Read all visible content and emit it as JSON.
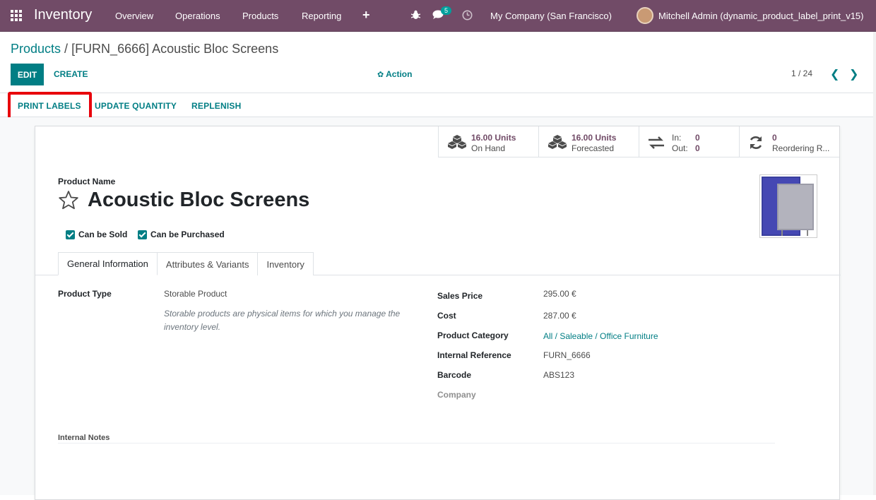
{
  "navbar": {
    "brand": "Inventory",
    "menu": [
      "Overview",
      "Operations",
      "Products",
      "Reporting"
    ],
    "add_label": "+",
    "chat_badge": "5",
    "company": "My Company (San Francisco)",
    "user": "Mitchell Admin (dynamic_product_label_print_v15)"
  },
  "breadcrumb": {
    "parent": "Products",
    "separator": " / ",
    "current": "[FURN_6666] Acoustic Bloc Screens"
  },
  "controls": {
    "edit": "EDIT",
    "create": "CREATE",
    "action": "Action",
    "pager": "1 / 24"
  },
  "button_bar": {
    "print_labels": "PRINT LABELS",
    "update_quantity": "UPDATE QUANTITY",
    "replenish": "REPLENISH"
  },
  "stats": {
    "on_hand_value": "16.00 Units",
    "on_hand_label": "On Hand",
    "forecasted_value": "16.00 Units",
    "forecasted_label": "Forecasted",
    "in_label": "In:",
    "in_value": "0",
    "out_label": "Out:",
    "out_value": "0",
    "reordering_value": "0",
    "reordering_label": "Reordering R..."
  },
  "product": {
    "name_label": "Product Name",
    "name": "Acoustic Bloc Screens",
    "can_be_sold": "Can be Sold",
    "can_be_purchased": "Can be Purchased"
  },
  "tabs": [
    "General Information",
    "Attributes & Variants",
    "Inventory"
  ],
  "general": {
    "product_type_label": "Product Type",
    "product_type": "Storable Product",
    "product_type_help": "Storable products are physical items for which you manage the inventory level.",
    "sales_price_label": "Sales Price",
    "sales_price": "295.00 €",
    "cost_label": "Cost",
    "cost": "287.00 €",
    "category_label": "Product Category",
    "category": "All / Saleable / Office Furniture",
    "internal_ref_label": "Internal Reference",
    "internal_ref": "FURN_6666",
    "barcode_label": "Barcode",
    "barcode": "ABS123",
    "company_label": "Company",
    "internal_notes_label": "Internal Notes"
  },
  "colors": {
    "brand": "#714b67",
    "accent": "#017e84",
    "highlight": "#e8000b"
  }
}
